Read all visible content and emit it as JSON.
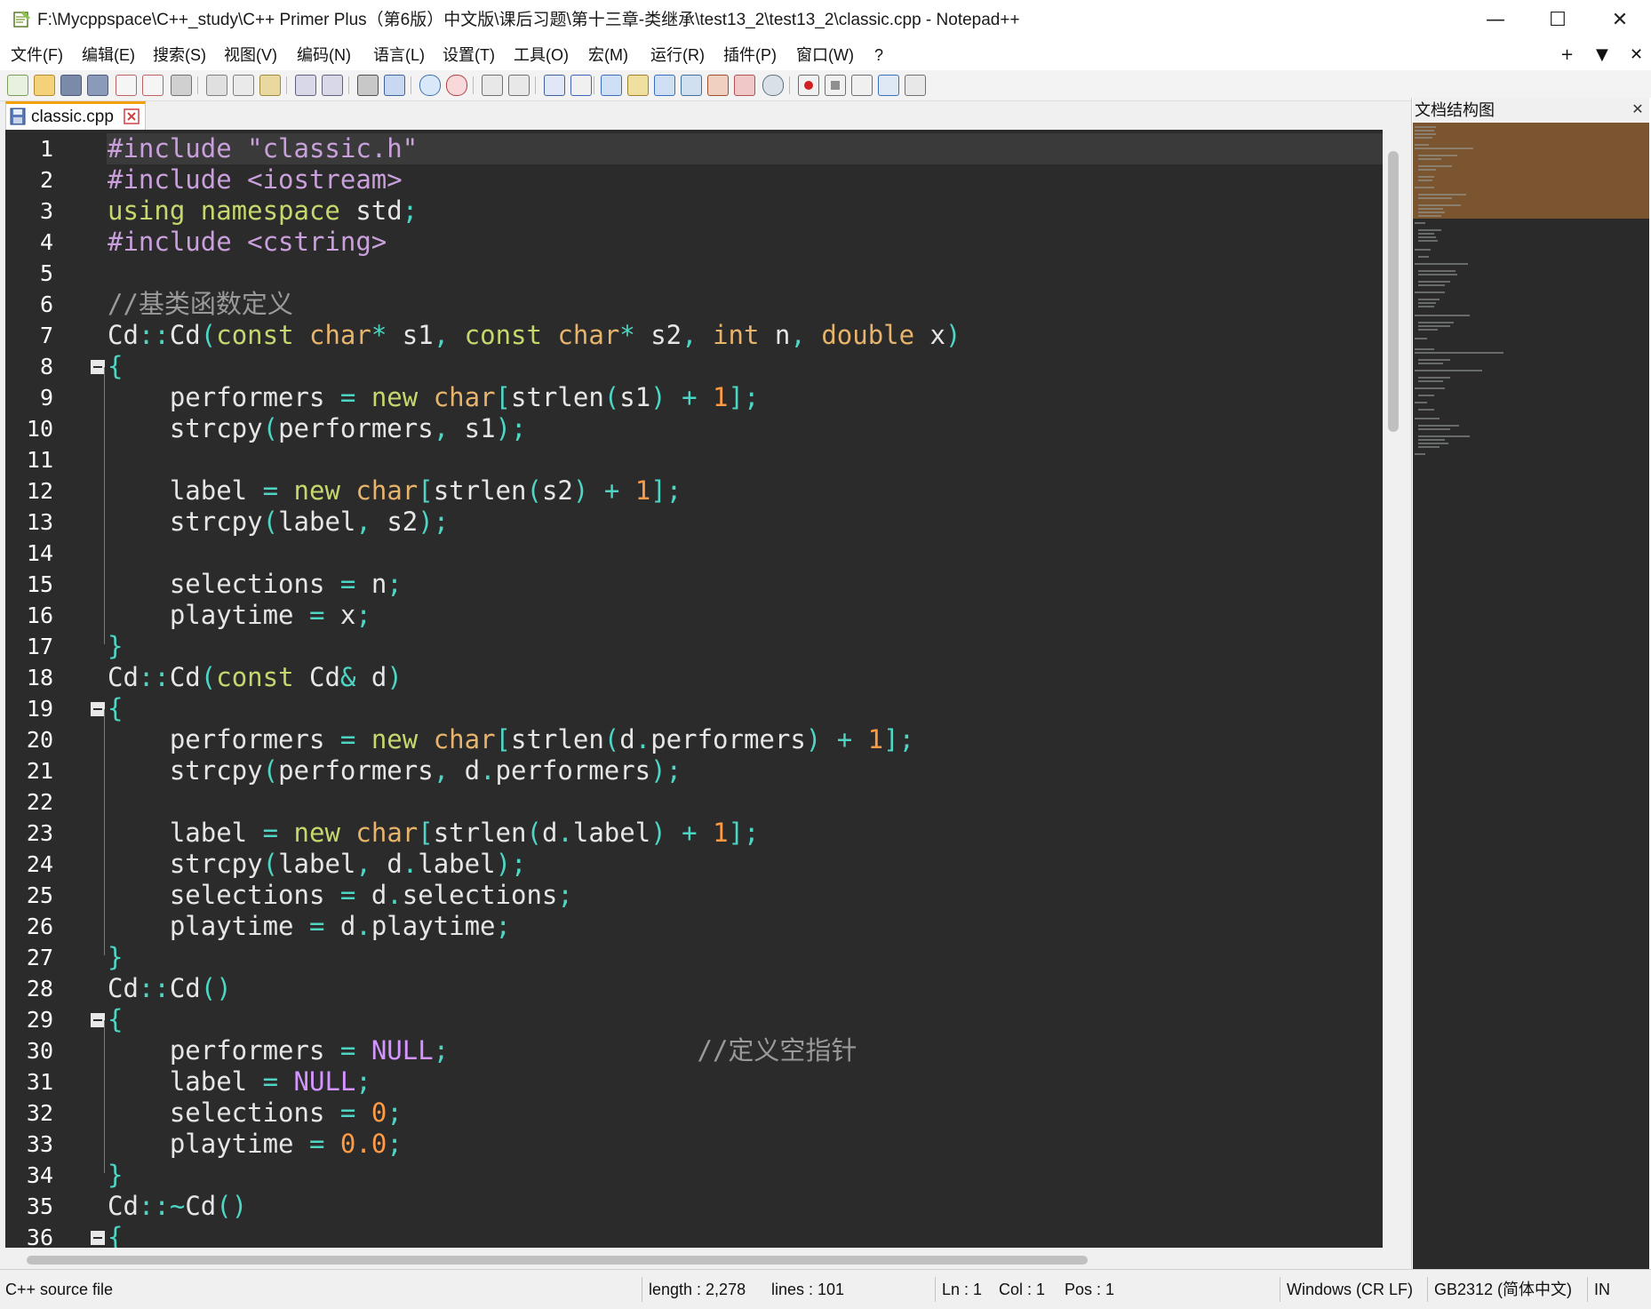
{
  "window": {
    "title": "F:\\Mycppspace\\C++_study\\C++ Primer Plus（第6版）中文版\\课后习题\\第十三章-类继承\\test13_2\\test13_2\\classic.cpp - Notepad++",
    "minimize": "—",
    "maximize": "☐",
    "close": "✕"
  },
  "menu": {
    "items": [
      "文件(F)",
      "编辑(E)",
      "搜索(S)",
      "视图(V)",
      "编码(N)",
      "语言(L)",
      "设置(T)",
      "工具(O)",
      "宏(M)",
      "运行(R)",
      "插件(P)",
      "窗口(W)",
      "?"
    ],
    "right": [
      "+",
      "▼",
      "✕"
    ]
  },
  "toolbar": {
    "icons": [
      "new-file-icon",
      "open-file-icon",
      "save-icon",
      "save-all-icon",
      "close-icon",
      "close-all-icon",
      "print-icon",
      "cut-icon",
      "copy-icon",
      "paste-icon",
      "undo-icon",
      "redo-icon",
      "find-icon",
      "replace-icon",
      "zoom-in-icon",
      "zoom-out-icon",
      "sync-vertical-icon",
      "sync-horizontal-icon",
      "word-wrap-icon",
      "show-all-chars-icon",
      "indent-guide-icon",
      "folder-workspace-icon",
      "document-map-icon",
      "function-list-icon",
      "udl-icon",
      "monitor-icon",
      "preview-icon",
      "record-macro-icon",
      "stop-macro-icon",
      "play-macro-icon",
      "run-macro-multiple-icon",
      "save-macro-icon"
    ]
  },
  "tab": {
    "label": "classic.cpp"
  },
  "editor": {
    "line_numbers": [
      "1",
      "2",
      "3",
      "4",
      "5",
      "6",
      "7",
      "8",
      "9",
      "10",
      "11",
      "12",
      "13",
      "14",
      "15",
      "16",
      "17",
      "18",
      "19",
      "20",
      "21",
      "22",
      "23",
      "24",
      "25",
      "26",
      "27",
      "28",
      "29",
      "30",
      "31",
      "32",
      "33",
      "34",
      "35",
      "36"
    ],
    "lines": [
      "#include \"classic.h\"",
      "#include <iostream>",
      "using namespace std;",
      "#include <cstring>",
      "",
      "//基类函数定义",
      "Cd::Cd(const char* s1, const char* s2, int n, double x)",
      "{",
      "    performers = new char[strlen(s1) + 1];",
      "    strcpy(performers, s1);",
      "",
      "    label = new char[strlen(s2) + 1];",
      "    strcpy(label, s2);",
      "",
      "    selections = n;",
      "    playtime = x;",
      "}",
      "Cd::Cd(const Cd& d)",
      "{",
      "    performers = new char[strlen(d.performers) + 1];",
      "    strcpy(performers, d.performers);",
      "",
      "    label = new char[strlen(d.label) + 1];",
      "    strcpy(label, d.label);",
      "    selections = d.selections;",
      "    playtime = d.playtime;",
      "}",
      "Cd::Cd()",
      "{",
      "    performers = NULL;                //定义空指针",
      "    label = NULL;",
      "    selections = 0;",
      "    playtime = 0.0;",
      "}",
      "Cd::~Cd()",
      "{"
    ]
  },
  "docmap": {
    "title": "文档结构图",
    "close": "✕"
  },
  "status": {
    "file_type": "C++ source file",
    "length": "length : 2,278",
    "lines": "lines : 101",
    "ln": "Ln : 1",
    "col": "Col : 1",
    "pos": "Pos : 1",
    "eol": "Windows (CR LF)",
    "encoding": "GB2312 (简体中文)",
    "mode": "IN"
  }
}
